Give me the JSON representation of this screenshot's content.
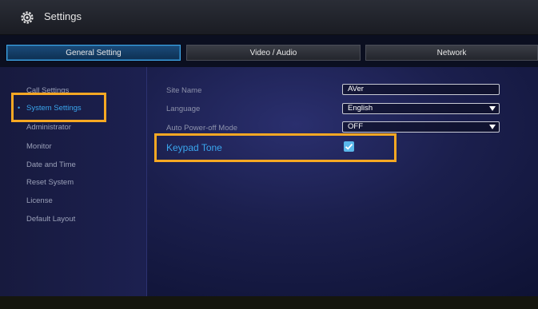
{
  "window": {
    "title": "Settings",
    "icon": "gear-icon"
  },
  "tabs": [
    {
      "label": "General Setting",
      "active": true
    },
    {
      "label": "Video / Audio",
      "active": false
    },
    {
      "label": "Network",
      "active": false
    }
  ],
  "sidebar": {
    "items": [
      {
        "label": "Call Settings",
        "active": false
      },
      {
        "label": "System Settings",
        "active": true
      },
      {
        "label": "Administrator",
        "active": false
      },
      {
        "label": "Monitor",
        "active": false
      },
      {
        "label": "Date and Time",
        "active": false
      },
      {
        "label": "Reset System",
        "active": false
      },
      {
        "label": "License",
        "active": false
      },
      {
        "label": "Default Layout",
        "active": false
      }
    ],
    "bullet": "•"
  },
  "settings": {
    "site_name": {
      "label": "Site Name",
      "value": "AVer"
    },
    "language": {
      "label": "Language",
      "value": "English"
    },
    "auto_power_off": {
      "label": "Auto Power-off Mode",
      "value": "OFF"
    },
    "keypad_tone": {
      "label": "Keypad Tone",
      "checked": true
    }
  },
  "colors": {
    "accent": "#3aa6ee",
    "highlight": "#f7a823",
    "background": "#1b1f4d"
  }
}
